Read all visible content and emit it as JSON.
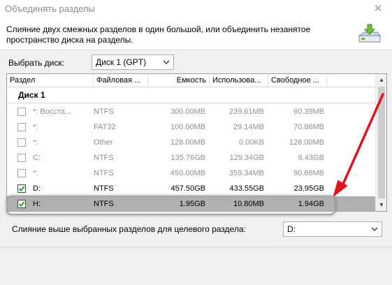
{
  "window": {
    "title": "Объединять разделы",
    "close_glyph": "✕"
  },
  "description": "Слияние двух смежных разделов в один большой, или объединить незанятое пространство диска на разделы.",
  "disk_select": {
    "label": "Выбрать диск:",
    "value": "Диск 1 (GPT)"
  },
  "table": {
    "columns": [
      "Раздел",
      "Файловая ...",
      "Емкость",
      "Использова...",
      "Свободное ..."
    ],
    "group": "Диск 1",
    "rows": [
      {
        "checked": false,
        "partition": "*: Восста...",
        "fs": "NTFS",
        "capacity": "300.00MB",
        "used": "239.61MB",
        "free": "60.39MB",
        "enabled": false
      },
      {
        "checked": false,
        "partition": "*:",
        "fs": "FAT32",
        "capacity": "100.00MB",
        "used": "29.14MB",
        "free": "70.86MB",
        "enabled": false
      },
      {
        "checked": false,
        "partition": "*:",
        "fs": "Other",
        "capacity": "128.00MB",
        "used": "0.00KB",
        "free": "128.00MB",
        "enabled": false
      },
      {
        "checked": false,
        "partition": "C:",
        "fs": "NTFS",
        "capacity": "135.76GB",
        "used": "129.34GB",
        "free": "6.43GB",
        "enabled": false
      },
      {
        "checked": false,
        "partition": "*:",
        "fs": "NTFS",
        "capacity": "450.00MB",
        "used": "359.34MB",
        "free": "90.66MB",
        "enabled": false
      },
      {
        "checked": true,
        "partition": "D:",
        "fs": "NTFS",
        "capacity": "457.50GB",
        "used": "433.55GB",
        "free": "23.95GB",
        "enabled": true
      },
      {
        "checked": true,
        "partition": "H:",
        "fs": "NTFS",
        "capacity": "1.95GB",
        "used": "10.80MB",
        "free": "1.94GB",
        "enabled": true,
        "selected": true
      }
    ]
  },
  "merge_target": {
    "label": "Слияние выше выбранных разделов для целевого раздела:",
    "value": "D:"
  },
  "colors": {
    "arrow": "#e0141a",
    "selected_row": "#b0b0b0",
    "check": "#2e9a2e"
  },
  "icons": {
    "close": "close-icon",
    "merge": "merge-partition-icon",
    "dropdown": "chevron-down-icon",
    "check": "checkmark-icon"
  }
}
